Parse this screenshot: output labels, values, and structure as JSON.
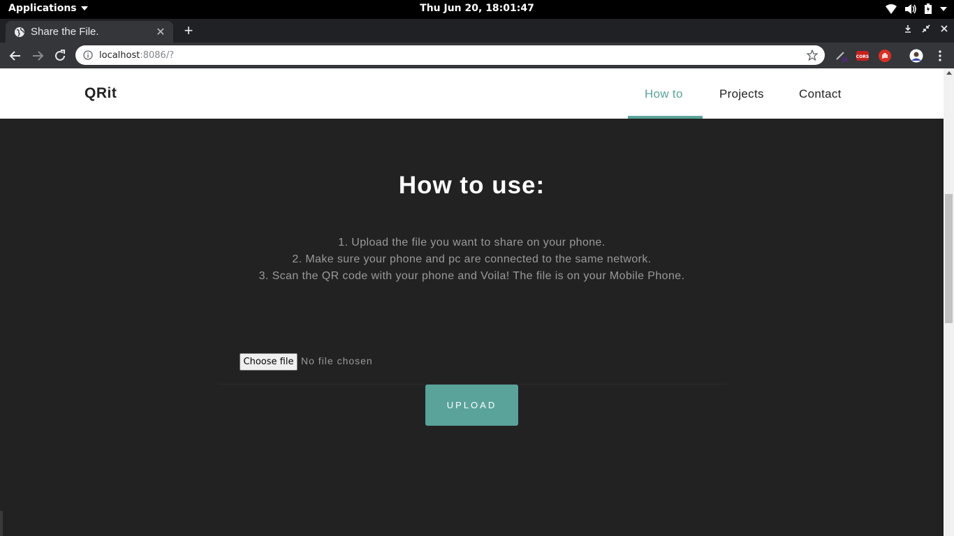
{
  "system_bar": {
    "applications_label": "Applications",
    "clock": "Thu Jun 20, 18:01:47"
  },
  "browser": {
    "tab_title": "Share the File.",
    "new_tab_label": "+",
    "url_host": "localhost",
    "url_path": ":8086/?"
  },
  "site": {
    "brand": "QRit",
    "nav": [
      {
        "label": "How to",
        "active": true
      },
      {
        "label": "Projects",
        "active": false
      },
      {
        "label": "Contact",
        "active": false
      }
    ],
    "accent_color": "#5aa39b"
  },
  "main": {
    "heading": "How to use:",
    "steps": [
      "1. Upload the file you want to share on your phone.",
      "2. Make sure your phone and pc are connected to the same network.",
      "3. Scan the QR code with your phone and Voila! The file is on your Mobile Phone."
    ],
    "file_input": {
      "button_label": "Choose file",
      "status": "No file chosen"
    },
    "upload_label": "UPLOAD"
  }
}
